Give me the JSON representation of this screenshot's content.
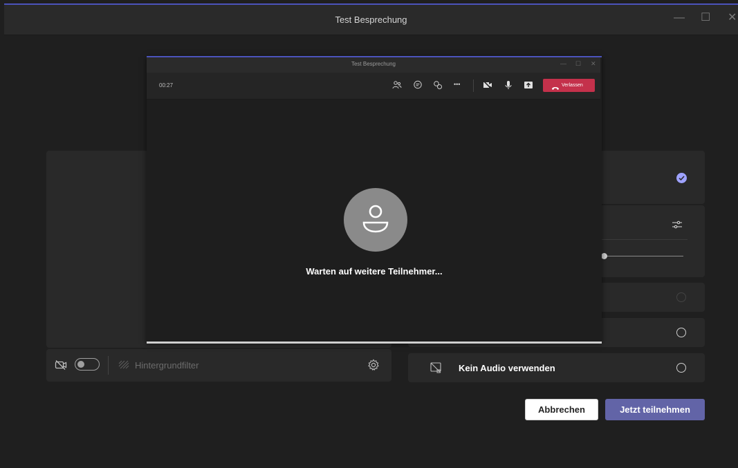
{
  "window": {
    "title": "Test Besprechung",
    "controls": {
      "minimize": "—",
      "maximize": "☐",
      "close": "✕"
    }
  },
  "preview": {
    "background_filter_label": "Hintergrundfilter",
    "camera_on": false
  },
  "audio_options": {
    "no_audio_label": "Kein Audio verwenden",
    "selected_option": "computer-audio"
  },
  "buttons": {
    "cancel": "Abbrechen",
    "join_now": "Jetzt teilnehmen"
  },
  "meeting_window": {
    "title": "Test Besprechung",
    "controls": {
      "minimize": "—",
      "maximize": "☐",
      "close": "✕"
    },
    "timer": "00:27",
    "leave_label": "Verlassen",
    "waiting_text": "Warten auf weitere Teilnehmer..."
  },
  "colors": {
    "accent": "#6264a7",
    "leave": "#c4314b",
    "selected_check": "#9ea2ff"
  },
  "icons": {
    "camera_off": "camera-off-icon",
    "background_effects": "background-effects-icon",
    "settings": "gear-icon",
    "audio_settings": "sliders-icon",
    "no_audio": "no-audio-icon",
    "participants": "participants-icon",
    "chat": "chat-icon",
    "reactions": "reactions-icon",
    "more": "more-icon",
    "video": "video-off-icon",
    "mic": "mic-icon",
    "share": "share-icon",
    "hang_up": "phone-hangup-icon",
    "avatar": "person-icon"
  }
}
